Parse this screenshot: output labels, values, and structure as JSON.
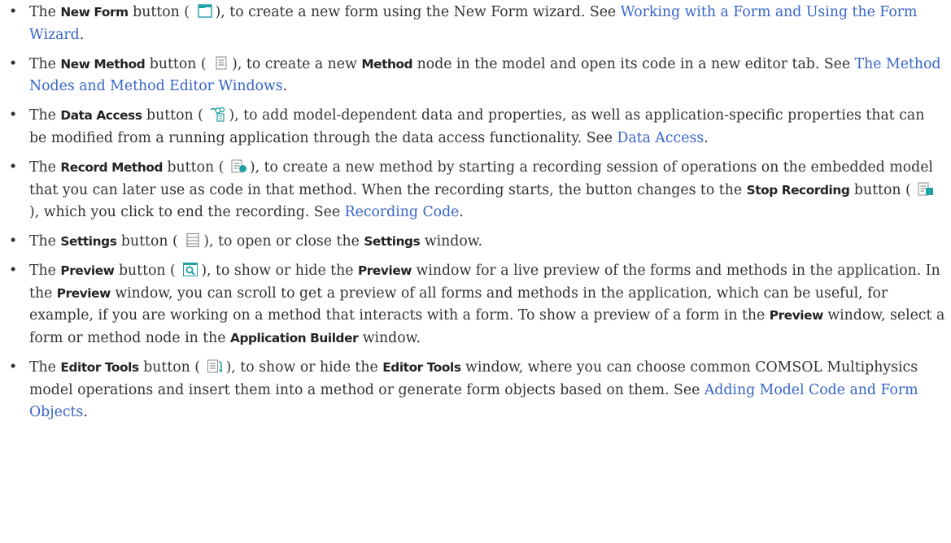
{
  "bullets": [
    {
      "prefix": "The ",
      "button": "New Form",
      "pre_icon": " button (",
      "icon": "new-form-icon",
      "post_icon": "), to create a new form using the New Form wizard. See ",
      "link": "Working with a Form and Using the Form Wizard",
      "end": "."
    },
    {
      "prefix": "The ",
      "button": "New Method",
      "pre_icon": " button (",
      "icon": "new-method-icon",
      "post_icon": "), to create a new ",
      "bold2": "Method",
      "post_bold2": " node in the model and open its code in a new editor tab. See ",
      "link": "The Method Nodes and Method Editor Windows",
      "end": "."
    },
    {
      "prefix": "The ",
      "button": "Data Access",
      "pre_icon": " button (",
      "icon": "data-access-icon",
      "post_icon": "), to add model-dependent data and properties, as well as application-specific properties that can be modified from a running application through the data access functionality. See ",
      "link": "Data Access",
      "end": "."
    },
    {
      "prefix": "The ",
      "button": "Record Method",
      "pre_icon": " button (",
      "icon": "record-method-icon",
      "post_icon": "), to create a new method by starting a recording session of operations on the embedded model that you can later use as code in that method. When the recording starts, the button changes to the ",
      "bold2": "Stop Recording",
      "pre_icon2": " button (",
      "icon2": "stop-recording-icon",
      "post_icon2": "), which you click to end the recording. See ",
      "link": "Recording Code",
      "end": "."
    },
    {
      "prefix": "The ",
      "button": "Settings",
      "pre_icon": " button (",
      "icon": "settings-icon",
      "post_icon": "), to open or close the ",
      "bold2": "Settings",
      "post_bold2": " window."
    },
    {
      "prefix": "The ",
      "button": "Preview",
      "pre_icon": " button (",
      "icon": "preview-icon",
      "post_icon": "), to show or hide the ",
      "bold2": "Preview",
      "post_bold2": " window for a live preview of the forms and methods in the application. In the ",
      "bold3": "Preview",
      "post_bold3": " window, you can scroll to get a preview of all forms and methods in the application, which can be useful, for example, if you are working on a method that interacts with a form. To show a preview of a form in the ",
      "bold4": "Preview",
      "post_bold4": " window, select a form or method node in the ",
      "bold5": "Application Builder",
      "post_bold5": " window."
    },
    {
      "prefix": "The ",
      "button": "Editor Tools",
      "pre_icon": " button (",
      "icon": "editor-tools-icon",
      "post_icon": "), to show or hide the ",
      "bold2": "Editor Tools",
      "post_bold2": " window, where you can choose common COMSOL Multiphysics model operations and insert them into a method or generate form objects based on them. See ",
      "link": "Adding Model Code and Form Objects",
      "end": "."
    }
  ],
  "bullet_char": "•",
  "colors": {
    "link": "#3765c8",
    "text": "#333333",
    "icon_teal": "#1f9fa6"
  }
}
